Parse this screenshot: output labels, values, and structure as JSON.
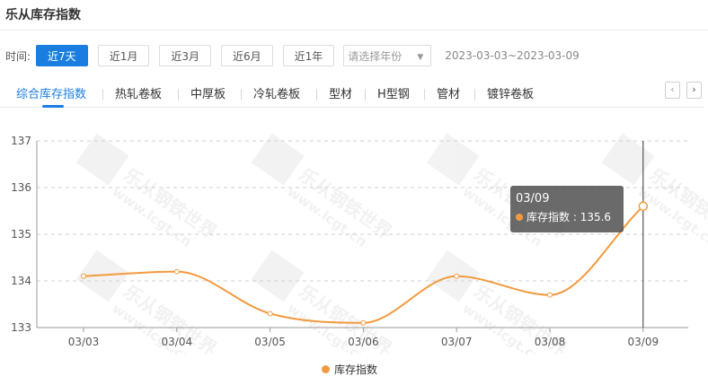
{
  "page": {
    "title": "乐从库存指数"
  },
  "range_selector": {
    "label": "时间:",
    "options": [
      "近7天",
      "近1月",
      "近3月",
      "近6月",
      "近1年"
    ],
    "active_index": 0,
    "year_placeholder": "请选择年份",
    "date_range": "2023-03-03~2023-03-09"
  },
  "tabs": {
    "items": [
      "综合库存指数",
      "热轧卷板",
      "中厚板",
      "冷轧卷板",
      "型材",
      "H型钢",
      "管材",
      "镀锌卷板"
    ],
    "active_index": 0,
    "prev_label": "‹",
    "next_label": "›"
  },
  "watermark": {
    "text": "乐从钢铁世界",
    "url_text": "www.lcgt.cn"
  },
  "colors": {
    "accent": "#1a7ee0",
    "series": "#f39a3e",
    "grid": "#d0d0d0"
  },
  "tooltip": {
    "date": "03/09",
    "series_name": "库存指数",
    "value": "135.6"
  },
  "chart_data": {
    "type": "line",
    "title": "",
    "xlabel": "",
    "ylabel": "",
    "x": [
      "03/03",
      "03/04",
      "03/05",
      "03/06",
      "03/07",
      "03/08",
      "03/09"
    ],
    "series": [
      {
        "name": "库存指数",
        "values": [
          134.1,
          134.2,
          133.3,
          133.1,
          134.1,
          133.7,
          135.6
        ]
      }
    ],
    "ylim": [
      133,
      137
    ],
    "yticks": [
      133,
      134,
      135,
      136,
      137
    ],
    "grid": true,
    "grid_style": "dashed",
    "smooth": true,
    "highlighted_index": 6,
    "legend_position": "bottom"
  }
}
